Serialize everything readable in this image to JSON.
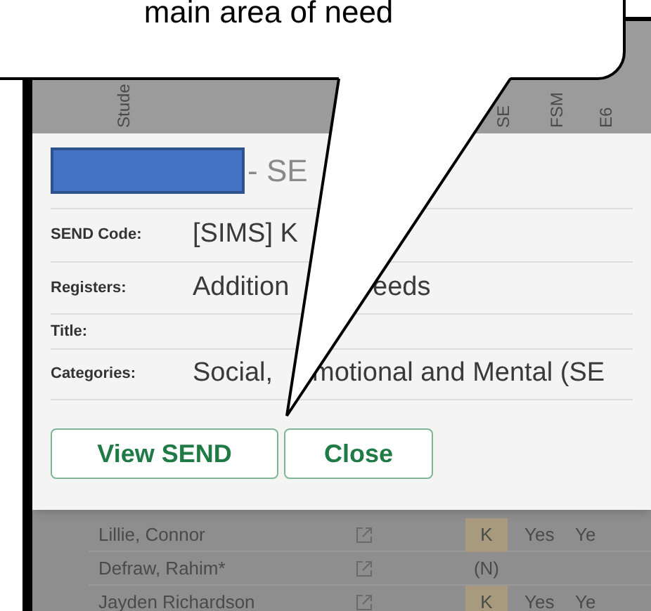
{
  "callout": {
    "text": "main area of need"
  },
  "table": {
    "columns": [
      "Stude",
      "SE",
      "FSM",
      "E6"
    ],
    "rows": [
      {
        "name": "Lillie, Connor",
        "sen": "K",
        "highlighted": true,
        "fsm": "Yes",
        "e6": "Ye"
      },
      {
        "name": "Defraw, Rahim*",
        "sen": "(N)",
        "highlighted": false
      },
      {
        "name": "Jayden Richardson",
        "sen": "K",
        "highlighted": true,
        "fsm": "Yes",
        "e6": "Ye"
      }
    ]
  },
  "dialog": {
    "title": "- SE",
    "fields": [
      {
        "label": "SEND Code:",
        "value": "[SIMS] K"
      },
      {
        "label": "Registers:",
        "value": "Addition",
        "value_after_pointer": "eeds"
      },
      {
        "label": "Title:"
      },
      {
        "label": "Categories:",
        "value": "Social,",
        "value_after_pointer": "motional and Mental (SE"
      }
    ],
    "buttons": [
      "View SEND",
      "Close"
    ]
  }
}
